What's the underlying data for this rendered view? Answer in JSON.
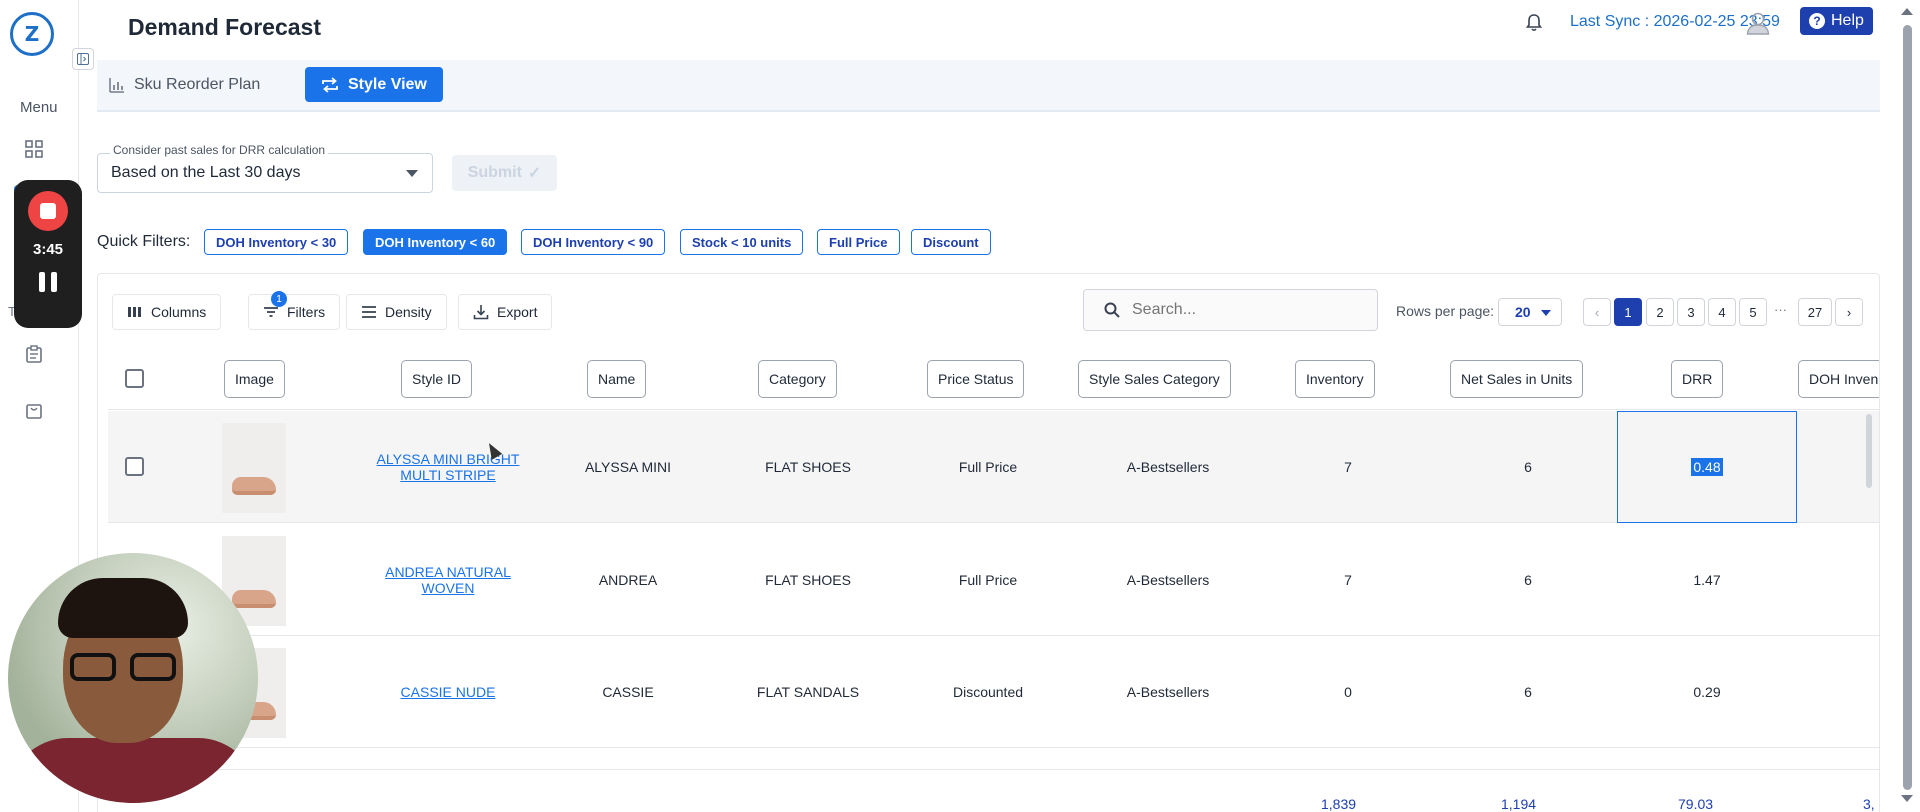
{
  "app": {
    "title": "Demand Forecast",
    "last_sync": "Last Sync : 2026-02-25 23:59",
    "help_label": "Help",
    "logo_letter": "Z"
  },
  "sidebar": {
    "menu_label": "Menu",
    "partial_label": "T"
  },
  "recorder": {
    "time": "3:45"
  },
  "tabs": [
    {
      "label": "Sku Reorder Plan",
      "icon": "bar-chart-icon",
      "active": false
    },
    {
      "label": "Style View",
      "icon": "swap-icon",
      "active": true
    }
  ],
  "drr_select": {
    "label": "Consider past sales for DRR calculation",
    "value": "Based on the Last 30 days"
  },
  "submit_label": "Submit",
  "quick_filters": {
    "label": "Quick Filters:",
    "chips": [
      {
        "label": "DOH Inventory < 30",
        "active": false
      },
      {
        "label": "DOH Inventory < 60",
        "active": true
      },
      {
        "label": "DOH Inventory < 90",
        "active": false
      },
      {
        "label": "Stock < 10 units",
        "active": false
      },
      {
        "label": "Full Price",
        "active": false
      },
      {
        "label": "Discount",
        "active": false
      }
    ]
  },
  "toolbar": {
    "columns": "Columns",
    "filters": "Filters",
    "filters_badge": "1",
    "density": "Density",
    "export": "Export"
  },
  "search": {
    "placeholder": "Search..."
  },
  "pagination": {
    "rows_label": "Rows per page:",
    "rows_value": "20",
    "pages": [
      "1",
      "2",
      "3",
      "4",
      "5",
      "27"
    ],
    "ellipsis": "···",
    "current": "1"
  },
  "table": {
    "headers": [
      "Image",
      "Style ID",
      "Name",
      "Category",
      "Price Status",
      "Style Sales Category",
      "Inventory",
      "Net Sales in Units",
      "DRR",
      "DOH Inven"
    ],
    "rows": [
      {
        "style_id": "ALYSSA MINI BRIGHT MULTI STRIPE",
        "name": "ALYSSA MINI",
        "category": "FLAT SHOES",
        "price_status": "Full Price",
        "sales_category": "A-Bestsellers",
        "inventory": "7",
        "net_sales": "6",
        "drr": "0.48"
      },
      {
        "style_id": "ANDREA NATURAL WOVEN",
        "name": "ANDREA",
        "category": "FLAT SHOES",
        "price_status": "Full Price",
        "sales_category": "A-Bestsellers",
        "inventory": "7",
        "net_sales": "6",
        "drr": "1.47"
      },
      {
        "style_id": "CASSIE NUDE",
        "name": "CASSIE",
        "category": "FLAT SANDALS",
        "price_status": "Discounted",
        "sales_category": "A-Bestsellers",
        "inventory": "0",
        "net_sales": "6",
        "drr": "0.29"
      }
    ],
    "totals": {
      "inventory": "1,839",
      "net_sales": "1,194",
      "drr": "79.03",
      "doh": "3,"
    }
  }
}
